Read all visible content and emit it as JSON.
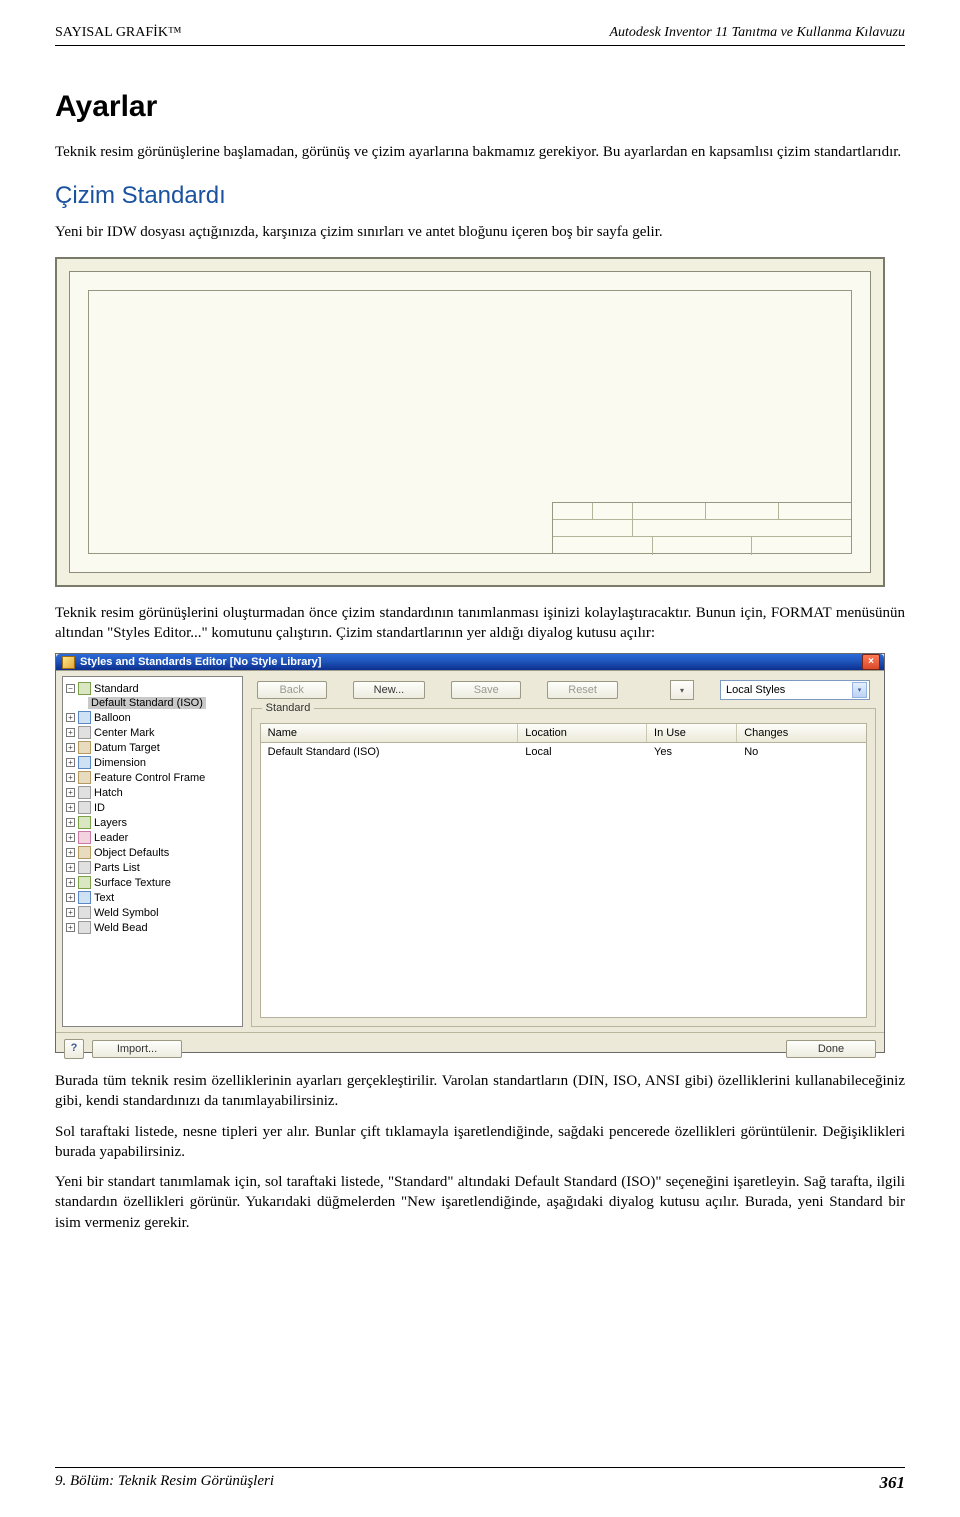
{
  "header": {
    "left": "SAYISAL GRAFİK™",
    "right": "Autodesk Inventor 11 Tanıtma ve Kullanma Kılavuzu"
  },
  "title": "Ayarlar",
  "intro": "Teknik resim görünüşlerine başlamadan, görünüş ve çizim ayarlarına bakmamız gerekiyor. Bu ayarlardan en kapsamlısı çizim standartlarıdır.",
  "section1_heading": "Çizim Standardı",
  "section1_p1": "Yeni bir IDW dosyası açtığınızda, karşınıza çizim sınırları ve antet bloğunu içeren boş bir sayfa gelir.",
  "section1_p2": "Teknik resim görünüşlerini oluşturmadan önce çizim standardının tanımlanması işinizi kolaylaştıracaktır. Bunun için, FORMAT menüsünün altından \"Styles Editor...\" komutunu çalıştırın. Çizim standartlarının yer aldığı diyalog kutusu açılır:",
  "dialog": {
    "title": "Styles and Standards Editor [No Style Library]",
    "toolbar": {
      "back": "Back",
      "new": "New...",
      "save": "Save",
      "reset": "Reset",
      "filter": "Local Styles"
    },
    "tree": {
      "root": "Standard",
      "selected": "Default Standard (ISO)",
      "items": [
        "Balloon",
        "Center Mark",
        "Datum Target",
        "Dimension",
        "Feature Control Frame",
        "Hatch",
        "ID",
        "Layers",
        "Leader",
        "Object Defaults",
        "Parts List",
        "Surface Texture",
        "Text",
        "Weld Symbol",
        "Weld Bead"
      ]
    },
    "group_caption": "Standard",
    "columns": {
      "c1": "Name",
      "c2": "Location",
      "c3": "In Use",
      "c4": "Changes"
    },
    "rows": [
      {
        "name": "Default Standard (ISO)",
        "location": "Local",
        "inuse": "Yes",
        "changes": "No"
      }
    ],
    "footer": {
      "import": "Import...",
      "done": "Done"
    }
  },
  "after_dialog": {
    "p1": "Burada tüm teknik resim özelliklerinin ayarları gerçekleştirilir. Varolan standartların (DIN, ISO, ANSI gibi) özelliklerini kullanabileceğiniz gibi, kendi standardınızı da tanımlayabilirsiniz.",
    "p2": "Sol taraftaki listede, nesne tipleri yer alır. Bunlar çift tıklamayla işaretlendiğinde, sağdaki pencerede özellikleri görüntülenir. Değişiklikleri burada yapabilirsiniz.",
    "p3": "Yeni bir standart tanımlamak için, sol taraftaki listede, \"Standard\" altındaki Default Standard (ISO)\" seçeneğini işaretleyin. Sağ tarafta, ilgili standardın özellikleri görünür. Yukarıdaki düğmelerden \"New işaretlendiğinde, aşağıdaki diyalog kutusu açılır. Burada, yeni Standard bir isim vermeniz gerekir."
  },
  "footer": {
    "chapter": "9. Bölüm: Teknik Resim Görünüşleri",
    "page": "361"
  }
}
